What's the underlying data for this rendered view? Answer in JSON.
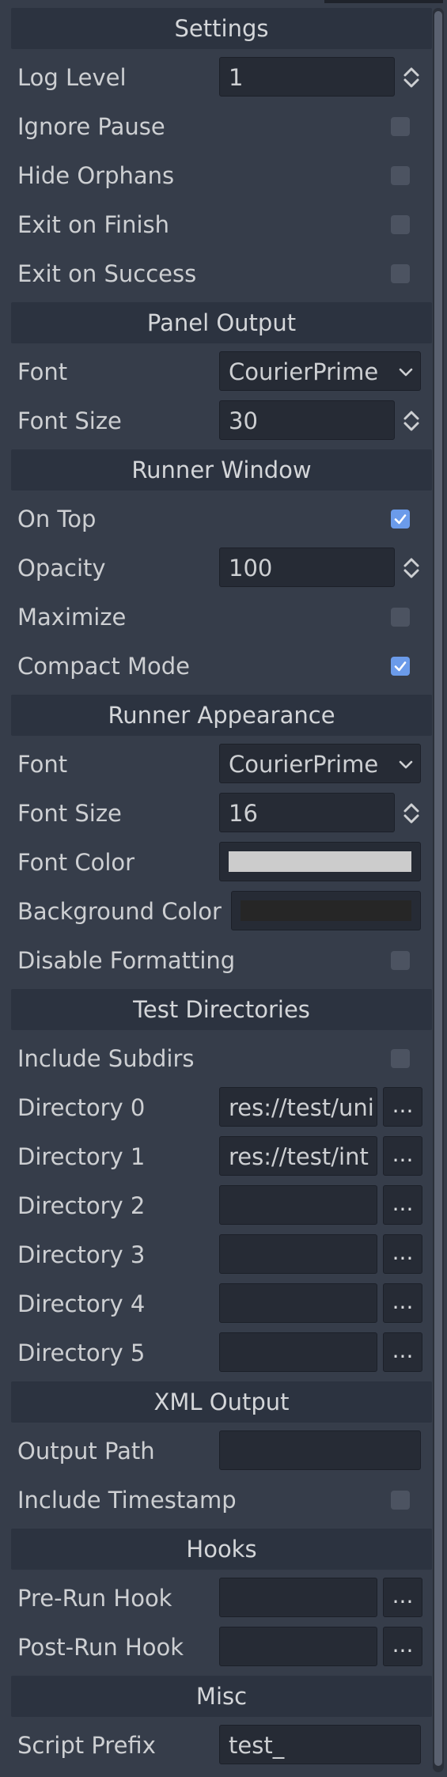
{
  "settings": {
    "title": "Settings",
    "log_level_label": "Log Level",
    "log_level_value": "1",
    "ignore_pause_label": "Ignore Pause",
    "ignore_pause_checked": false,
    "hide_orphans_label": "Hide Orphans",
    "hide_orphans_checked": false,
    "exit_on_finish_label": "Exit on Finish",
    "exit_on_finish_checked": false,
    "exit_on_success_label": "Exit on Success",
    "exit_on_success_checked": false
  },
  "panel_output": {
    "title": "Panel Output",
    "font_label": "Font",
    "font_value": "CourierPrime",
    "font_size_label": "Font Size",
    "font_size_value": "30"
  },
  "runner_window": {
    "title": "Runner Window",
    "on_top_label": "On Top",
    "on_top_checked": true,
    "opacity_label": "Opacity",
    "opacity_value": "100",
    "maximize_label": "Maximize",
    "maximize_checked": false,
    "compact_mode_label": "Compact Mode",
    "compact_mode_checked": true
  },
  "runner_appearance": {
    "title": "Runner Appearance",
    "font_label": "Font",
    "font_value": "CourierPrime",
    "font_size_label": "Font Size",
    "font_size_value": "16",
    "font_color_label": "Font Color",
    "font_color": "#cccccc",
    "background_color_label": "Background Color",
    "background_color": "#262626",
    "disable_formatting_label": "Disable Formatting",
    "disable_formatting_checked": false
  },
  "test_directories": {
    "title": "Test Directories",
    "include_subdirs_label": "Include Subdirs",
    "include_subdirs_checked": false,
    "browse_label": "...",
    "directories": [
      {
        "label": "Directory 0",
        "value": "res://test/uni"
      },
      {
        "label": "Directory 1",
        "value": "res://test/int"
      },
      {
        "label": "Directory 2",
        "value": ""
      },
      {
        "label": "Directory 3",
        "value": ""
      },
      {
        "label": "Directory 4",
        "value": ""
      },
      {
        "label": "Directory 5",
        "value": ""
      }
    ]
  },
  "xml_output": {
    "title": "XML Output",
    "output_path_label": "Output Path",
    "output_path_value": "",
    "include_timestamp_label": "Include Timestamp",
    "include_timestamp_checked": false
  },
  "hooks": {
    "title": "Hooks",
    "pre_run_label": "Pre-Run Hook",
    "pre_run_value": "",
    "post_run_label": "Post-Run Hook",
    "post_run_value": "",
    "browse_label": "..."
  },
  "misc": {
    "title": "Misc",
    "script_prefix_label": "Script Prefix",
    "script_prefix_value": "test_"
  },
  "colors": {
    "accent": "#6b9bea",
    "panel_bg": "#363d4a",
    "header_bg": "#2c3340",
    "field_bg": "#262b35"
  },
  "icons": {
    "spin": "updown-arrows-icon",
    "dropdown": "chevron-down-icon",
    "check": "checkmark-icon"
  }
}
